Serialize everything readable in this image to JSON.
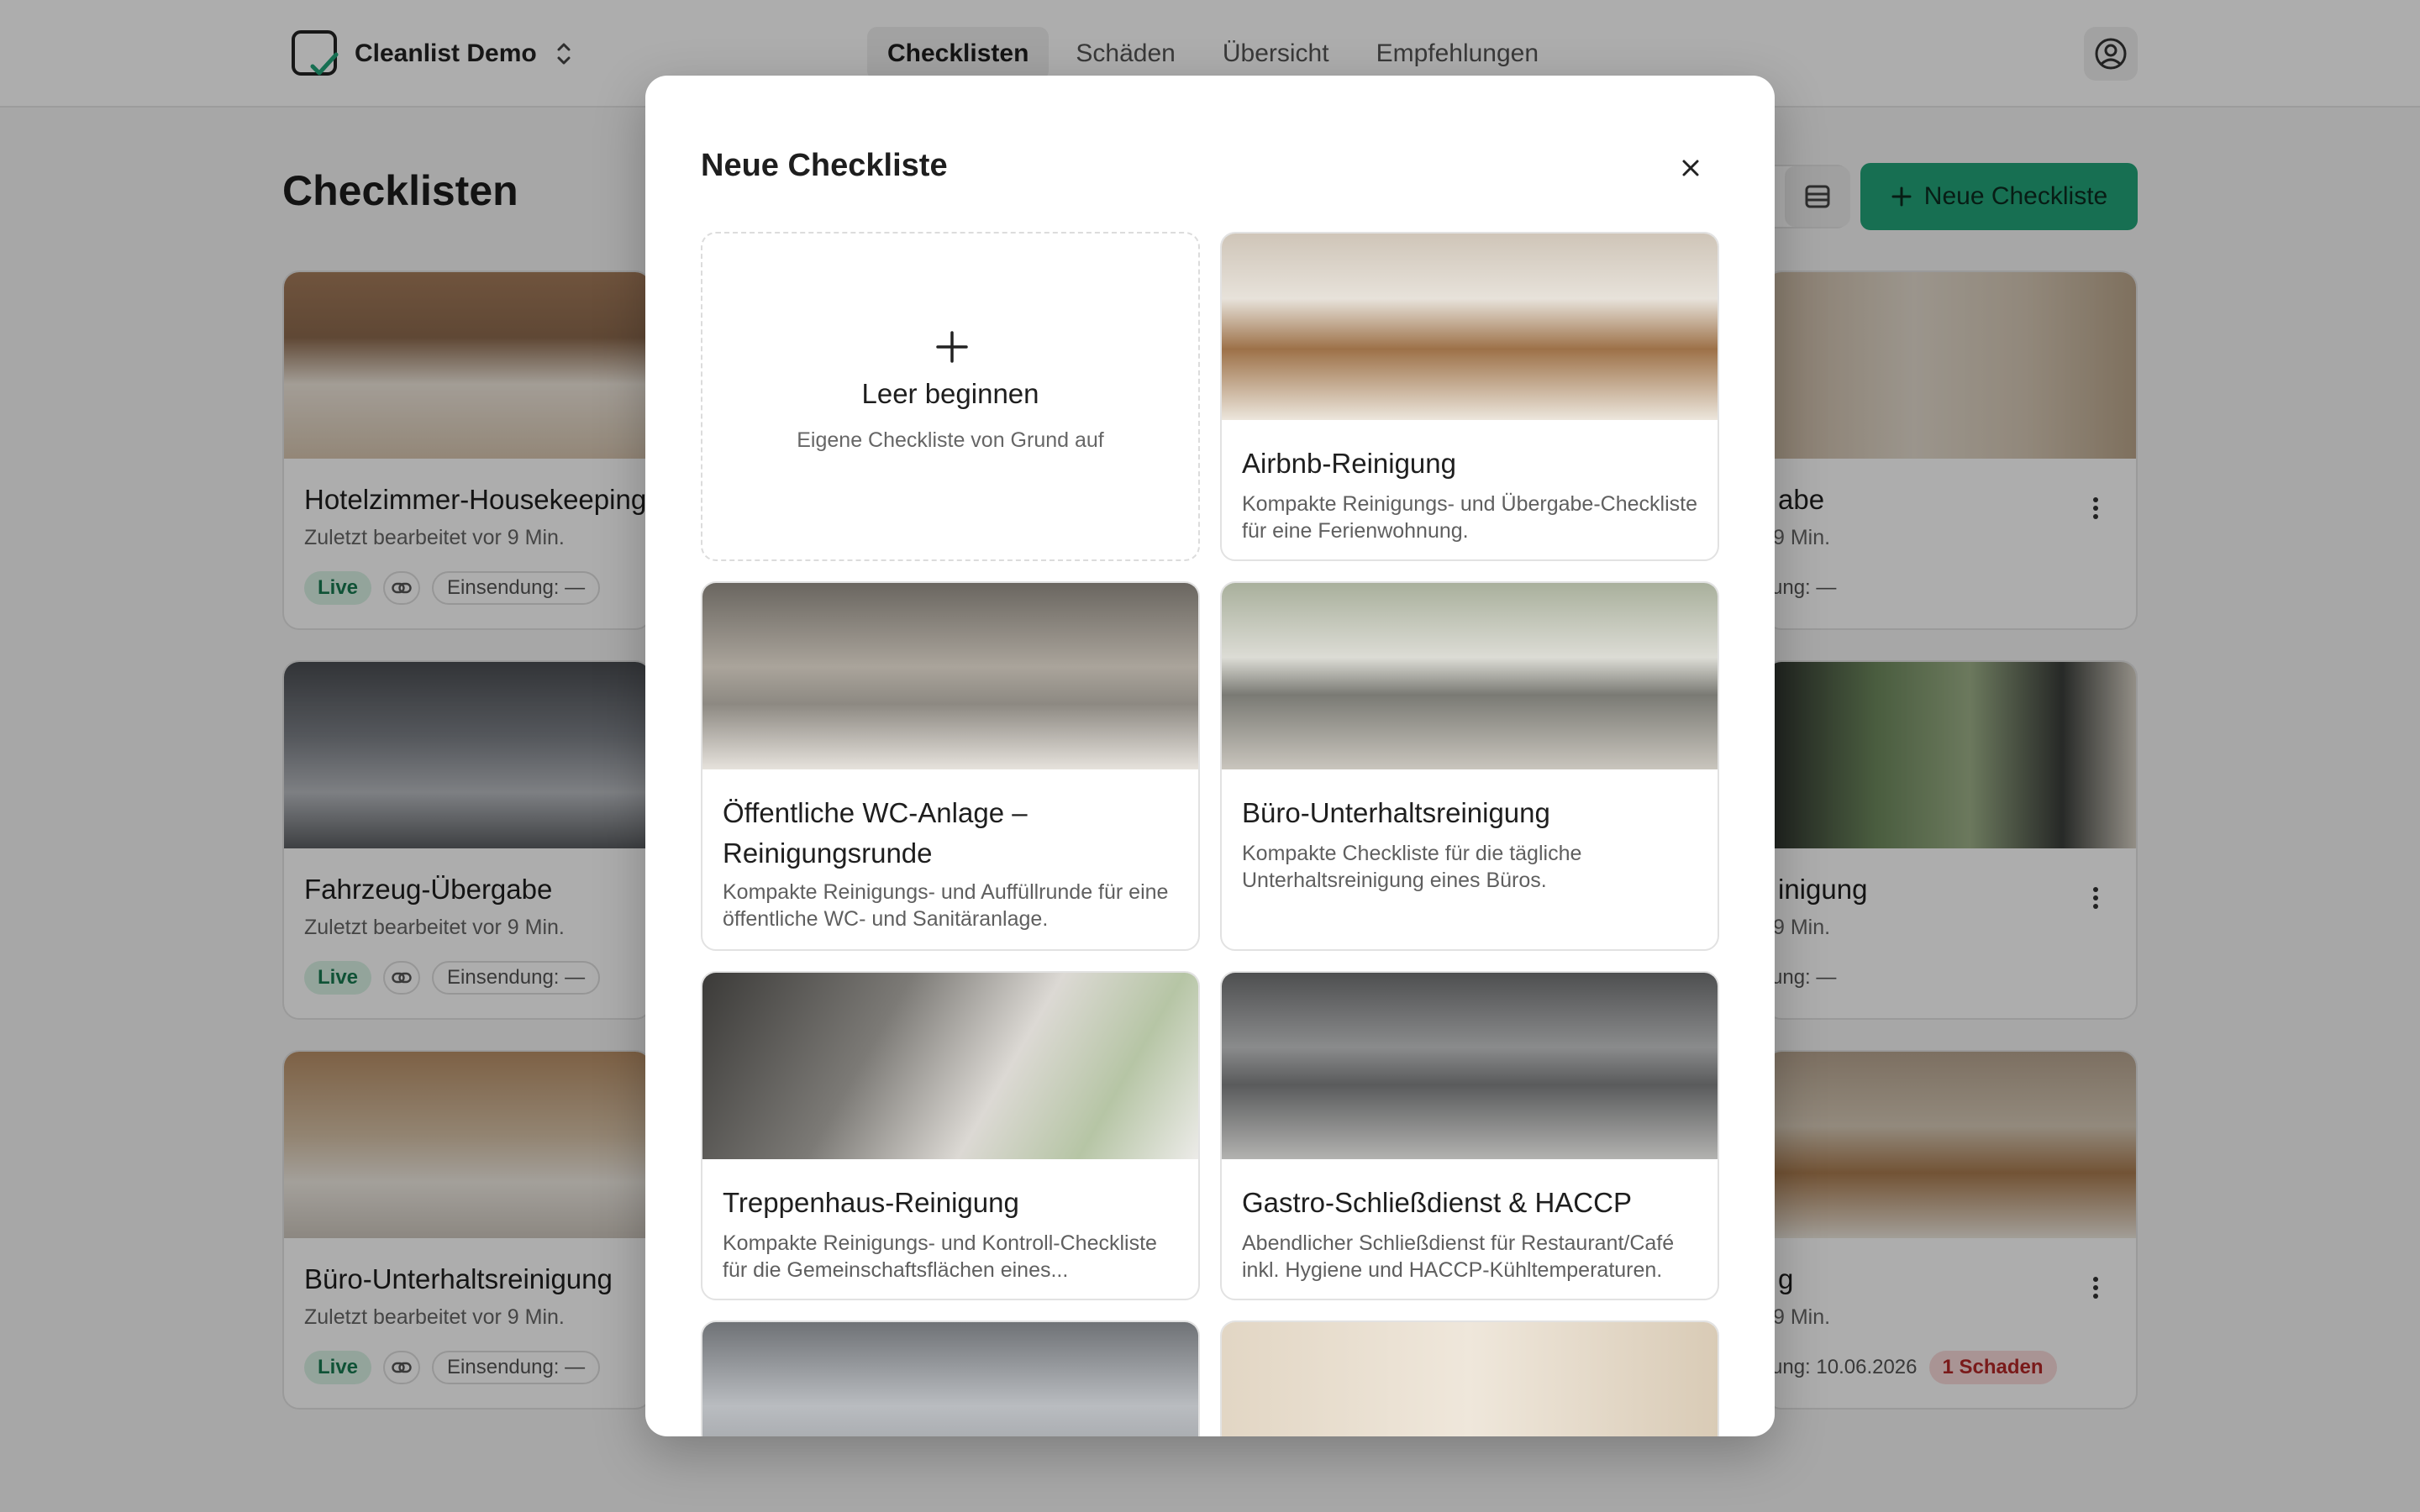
{
  "app": {
    "workspace_name": "Cleanlist Demo"
  },
  "nav": {
    "tabs": [
      {
        "label": "Checklisten",
        "active": true
      },
      {
        "label": "Schäden",
        "active": false
      },
      {
        "label": "Übersicht",
        "active": false
      },
      {
        "label": "Empfehlungen",
        "active": false
      }
    ]
  },
  "page": {
    "title": "Checklisten",
    "new_button_label": "Neue Checkliste"
  },
  "cards": [
    {
      "title": "Hotelzimmer-Housekeeping",
      "subtitle": "Zuletzt bearbeitet vor 9 Min.",
      "status": "Live",
      "submission": "Einsendung: —"
    },
    {
      "title": "Fahrzeug-Übergabe",
      "subtitle": "Zuletzt bearbeitet vor 9 Min.",
      "status": "Live",
      "submission": "Einsendung: —"
    },
    {
      "title": "Büro-Unterhaltsreinigung",
      "subtitle": "Zuletzt bearbeitet vor 9 Min.",
      "status": "Live",
      "submission": "Einsendung: —"
    }
  ],
  "right_cards": [
    {
      "title_fragment": "abe",
      "subtitle_fragment": "9 Min.",
      "submission_fragment": "ung: —"
    },
    {
      "title_fragment": "inigung",
      "subtitle_fragment": "9 Min.",
      "submission_fragment": "ung: —"
    },
    {
      "title_fragment": "g",
      "subtitle_fragment": "9 Min.",
      "submission_fragment": "ung: 10.06.2026",
      "damage_badge": "1 Schaden"
    }
  ],
  "modal": {
    "title": "Neue Checkliste",
    "empty_template": {
      "title": "Leer beginnen",
      "subtitle": "Eigene Checkliste von Grund auf"
    },
    "templates": [
      {
        "title": "Airbnb-Reinigung",
        "description": "Kompakte Reinigungs- und Übergabe-Checkliste für eine Ferienwohnung."
      },
      {
        "title": "Öffentliche WC-Anlage – Reinigungsrunde",
        "description": "Kompakte Reinigungs- und Auffüllrunde für eine öffentliche WC- und Sanitäranlage."
      },
      {
        "title": "Büro-Unterhaltsreinigung",
        "description": "Kompakte Checkliste für die tägliche Unterhaltsreinigung eines Büros."
      },
      {
        "title": "Treppenhaus-Reinigung",
        "description": "Kompakte Reinigungs- und Kontroll-Checkliste für die Gemeinschaftsflächen eines..."
      },
      {
        "title": "Gastro-Schließdienst & HACCP",
        "description": "Abendlicher Schließdienst für Restaurant/Café inkl. Hygiene und HACCP-Kühltemperaturen."
      }
    ]
  },
  "colors": {
    "accent": "#22a47a",
    "live_bg": "#d9f2e5",
    "live_text": "#177a50",
    "damage_bg": "#f9dada",
    "damage_text": "#b42727"
  }
}
